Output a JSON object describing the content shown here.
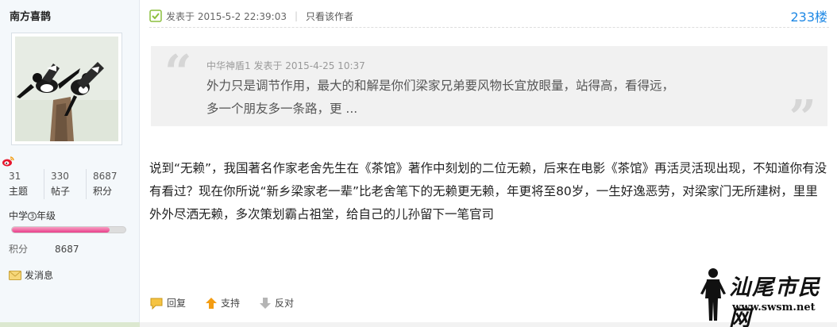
{
  "user": {
    "name": "南方喜鹊",
    "stats": [
      {
        "value": "31",
        "label": "主题"
      },
      {
        "value": "330",
        "label": "帖子"
      },
      {
        "value": "8687",
        "label": "积分"
      }
    ],
    "level_prefix": "中学",
    "level_num": "3",
    "level_suffix": "年级",
    "level_progress": 0.86,
    "points_label": "积分",
    "points_value": "8687",
    "send_message": "发消息"
  },
  "post": {
    "posted_label": "发表于 2015-5-2 22:39:03",
    "only_author": "只看该作者",
    "floor": "233楼",
    "quote": {
      "meta": "中华神盾1 发表于 2015-4-25 10:37",
      "line1": "外力只是调节作用，最大的和解是你们梁家兄弟要风物长宜放眼量，站得高，看得远，",
      "line2": "多一个朋友多一条路，更 ..."
    },
    "body": "说到“无赖”，我国著名作家老舍先生在《茶馆》著作中刻划的二位无赖，后来在电影《茶馆》再活灵活现出现，不知道你有没有看过？现在你所说“新乡梁家老一辈”比老舍笔下的无赖更无赖，年更将至80岁，一生好逸恶劳，对梁家门无所建树，里里外外尽洒无赖，多次策划霸占祖堂，给自己的儿孙留下一笔官司"
  },
  "actions": {
    "reply": "回复",
    "support": "支持",
    "oppose": "反对"
  },
  "watermark": {
    "title": "汕尾市民网",
    "url": "www.swsm.net"
  },
  "colors": {
    "floor": "#1e88e5",
    "level_bar": "#e93e8a",
    "support_arrow": "#f39c12"
  }
}
